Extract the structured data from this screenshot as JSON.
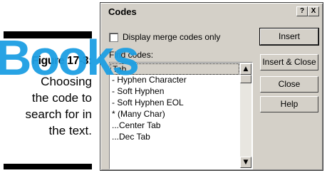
{
  "caption": {
    "figure_label": "Figure 17-3:",
    "text": "Choosing\nthe code to\nsearch for in\nthe text."
  },
  "watermark": "Books",
  "dialog": {
    "title": "Codes",
    "help_glyph": "?",
    "close_glyph": "X",
    "checkbox_label": "Display merge codes only",
    "checkbox_checked": false,
    "find_label": "Find codes:",
    "list_items": [
      "Tab",
      "- Hyphen Character",
      "- Soft Hyphen",
      "- Soft Hyphen EOL",
      "* (Many Char)",
      "...Center Tab",
      "...Dec Tab"
    ],
    "selected_index": 0,
    "scroll_up_glyph": "▲",
    "scroll_down_glyph": "▼",
    "buttons": {
      "insert": "Insert",
      "insert_close": "Insert & Close",
      "close": "Close",
      "help": "Help"
    }
  }
}
